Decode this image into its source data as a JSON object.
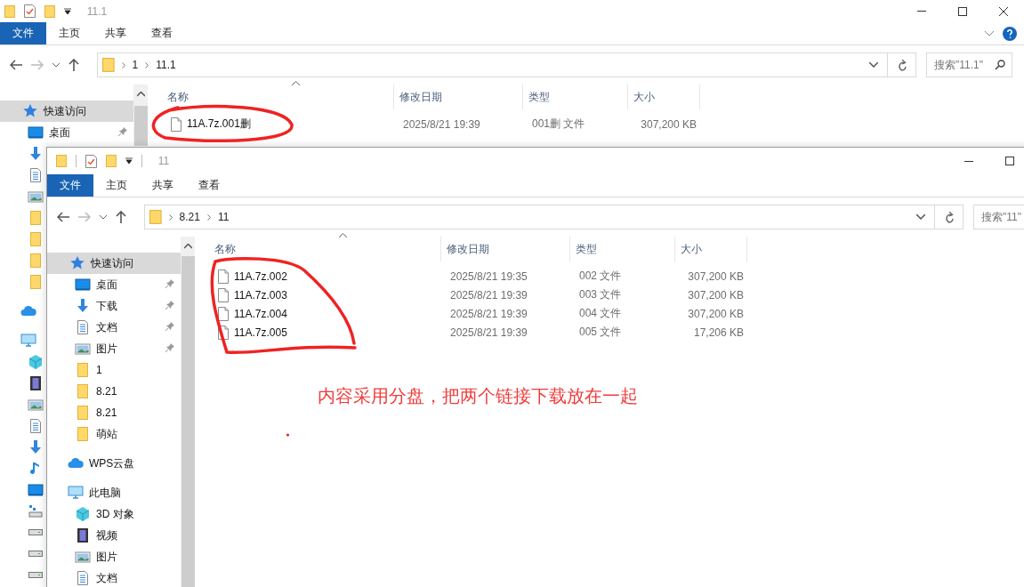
{
  "windows": [
    {
      "title": "11.1",
      "ribbon_tabs": [
        {
          "label": "文件",
          "selected": true
        },
        {
          "label": "主页",
          "selected": false
        },
        {
          "label": "共享",
          "selected": false
        },
        {
          "label": "查看",
          "selected": false
        }
      ],
      "breadcrumb": [
        "1",
        "11.1"
      ],
      "search": {
        "placeholder": "搜索\"11.1\""
      },
      "nav": [
        {
          "kind": "quick-access",
          "label": "快速访问",
          "selected": true,
          "children": [
            {
              "kind": "desktop",
              "label": "桌面",
              "pinned": true,
              "selected": false
            },
            {
              "kind": "download",
              "selected": false
            },
            {
              "kind": "document",
              "selected": false
            },
            {
              "kind": "picture",
              "selected": false
            },
            {
              "kind": "folder",
              "selected": false
            },
            {
              "kind": "folder",
              "selected": false
            },
            {
              "kind": "folder",
              "selected": false
            },
            {
              "kind": "folder",
              "selected": false
            }
          ]
        },
        {
          "kind": "cloud",
          "selected": false
        },
        {
          "kind": "pc",
          "selected": false,
          "children": [
            {
              "kind": "cube",
              "selected": false
            },
            {
              "kind": "video",
              "selected": false
            },
            {
              "kind": "picture",
              "selected": false
            },
            {
              "kind": "document",
              "selected": false
            },
            {
              "kind": "download",
              "selected": false
            },
            {
              "kind": "music",
              "selected": false
            },
            {
              "kind": "desktop",
              "selected": false
            },
            {
              "kind": "network-drive",
              "selected": false
            },
            {
              "kind": "drive",
              "selected": false
            },
            {
              "kind": "drive",
              "selected": false
            },
            {
              "kind": "drive",
              "selected": false
            }
          ]
        }
      ],
      "columns": [
        "名称",
        "修改日期",
        "类型",
        "大小"
      ],
      "files": [
        {
          "name": "11A.7z.001删",
          "modified": "2025/8/21 19:39",
          "type": "001删 文件",
          "size": "307,200 KB"
        }
      ]
    },
    {
      "title": "11",
      "ribbon_tabs": [
        {
          "label": "文件",
          "selected": true
        },
        {
          "label": "主页",
          "selected": false
        },
        {
          "label": "共享",
          "selected": false
        },
        {
          "label": "查看",
          "selected": false
        }
      ],
      "breadcrumb": [
        "8.21",
        "11"
      ],
      "search": {
        "placeholder": "搜索\"11\""
      },
      "nav": [
        {
          "kind": "quick-access",
          "label": "快速访问",
          "selected": true,
          "children": [
            {
              "kind": "desktop",
              "label": "桌面",
              "pinned": true,
              "selected": false
            },
            {
              "kind": "download",
              "label": "下载",
              "pinned": true,
              "selected": false
            },
            {
              "kind": "document",
              "label": "文档",
              "pinned": true,
              "selected": false
            },
            {
              "kind": "picture",
              "label": "图片",
              "pinned": true,
              "selected": false
            },
            {
              "kind": "folder",
              "label": "1",
              "pinned": false,
              "selected": false
            },
            {
              "kind": "folder",
              "label": "8.21",
              "pinned": false,
              "selected": false
            },
            {
              "kind": "folder",
              "label": "8.21",
              "pinned": false,
              "selected": false
            },
            {
              "kind": "folder",
              "label": "萌站",
              "pinned": false,
              "selected": false
            }
          ]
        },
        {
          "kind": "cloud",
          "label": "WPS云盘",
          "selected": false
        },
        {
          "kind": "pc",
          "label": "此电脑",
          "selected": false,
          "children": [
            {
              "kind": "cube",
              "label": "3D 对象",
              "selected": false
            },
            {
              "kind": "video",
              "label": "视频",
              "selected": false
            },
            {
              "kind": "picture",
              "label": "图片",
              "selected": false
            },
            {
              "kind": "document",
              "label": "文档",
              "selected": false
            }
          ]
        }
      ],
      "columns": [
        "名称",
        "修改日期",
        "类型",
        "大小"
      ],
      "files": [
        {
          "name": "11A.7z.002",
          "modified": "2025/8/21 19:35",
          "type": "002 文件",
          "size": "307,200 KB"
        },
        {
          "name": "11A.7z.003",
          "modified": "2025/8/21 19:39",
          "type": "003 文件",
          "size": "307,200 KB"
        },
        {
          "name": "11A.7z.004",
          "modified": "2025/8/21 19:39",
          "type": "004 文件",
          "size": "307,200 KB"
        },
        {
          "name": "11A.7z.005",
          "modified": "2025/8/21 19:39",
          "type": "005 文件",
          "size": "17,206 KB"
        }
      ]
    }
  ],
  "annotation": {
    "text": "内容采用分盘，把两个链接下载放在一起"
  }
}
